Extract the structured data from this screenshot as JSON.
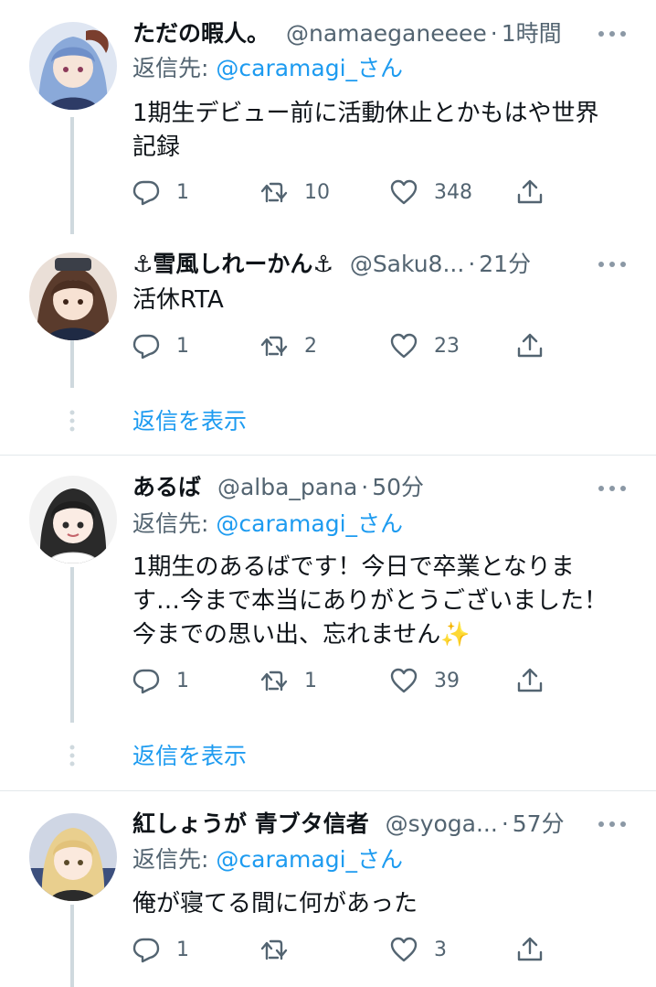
{
  "tweets": [
    {
      "name": "ただの暇人。",
      "handle": "@namaeganeeee",
      "separator": "·",
      "time": "1時間",
      "reply_prefix": "返信先: ",
      "reply_to": "@caramagi_さん",
      "text": "1期生デビュー前に活動休止とかもはや世界\n記録",
      "replies": "1",
      "retweets": "10",
      "likes": "348"
    },
    {
      "name_prefix": "⚓",
      "name": "雪風しれーかん",
      "name_suffix": "⚓",
      "handle": "@Saku8...",
      "separator": "·",
      "time": "21分",
      "text": "活休RTA",
      "replies": "1",
      "retweets": "2",
      "likes": "23",
      "show_replies": "返信を表示"
    },
    {
      "name": "あるば",
      "handle": "@alba_pana",
      "separator": "·",
      "time": "50分",
      "reply_prefix": "返信先: ",
      "reply_to": "@caramagi_さん",
      "text": "1期生のあるばです！今日で卒業となりま\nす…今まで本当にありがとうございました！\n今までの思い出、忘れません✨",
      "replies": "1",
      "retweets": "1",
      "likes": "39",
      "show_replies": "返信を表示"
    },
    {
      "name": "紅しょうが 青ブタ信者",
      "handle": "@syoga...",
      "separator": "·",
      "time": "57分",
      "reply_prefix": "返信先: ",
      "reply_to": "@caramagi_さん",
      "text": "俺が寝てる間に何があった",
      "replies": "1",
      "retweets": "",
      "likes": "3"
    }
  ],
  "icons": {
    "reply": "reply-icon",
    "retweet": "retweet-icon",
    "like": "heart-icon",
    "share": "share-icon",
    "more": "more-icon"
  },
  "colors": {
    "accent": "#1d9bf0",
    "secondary_text": "#536471",
    "thread_line": "#cfd9de"
  }
}
